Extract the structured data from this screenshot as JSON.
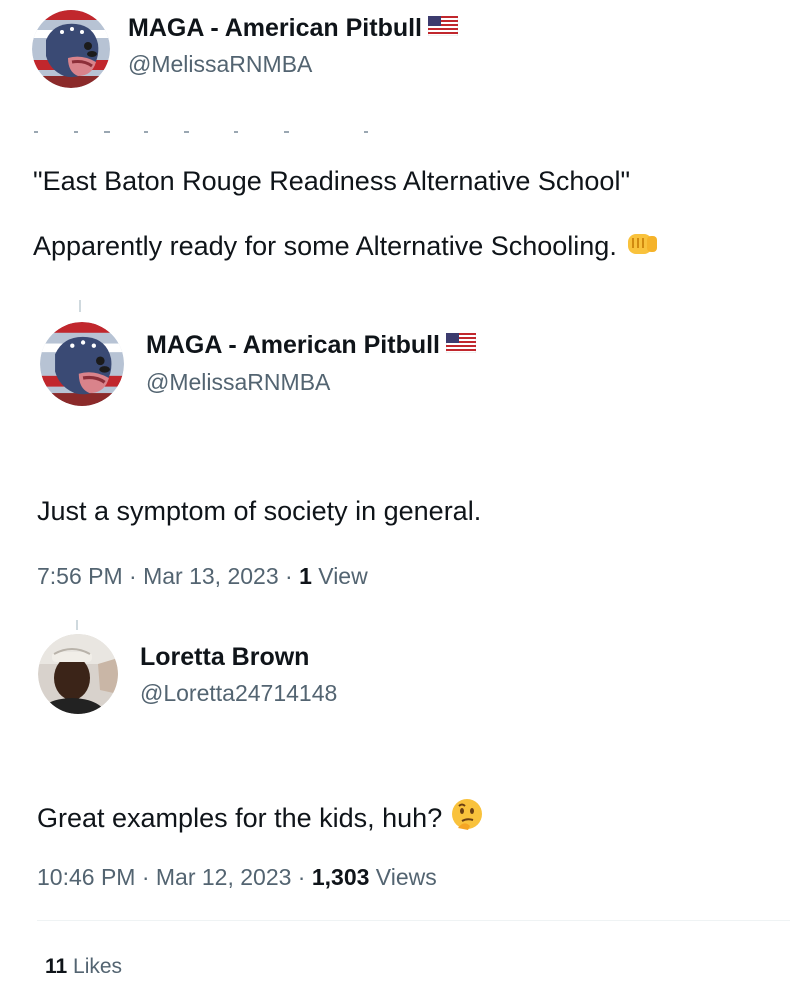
{
  "tweet1": {
    "name": "MAGA - American Pitbull",
    "flag": "us-flag-icon",
    "handle": "@MelissaRNMBA",
    "line1": "\"East Baton Rouge Readiness Alternative School\"",
    "line2": "Apparently ready for some Alternative Schooling.",
    "emoji": "oncoming-fist-icon"
  },
  "tweet2": {
    "name": "MAGA - American Pitbull",
    "flag": "us-flag-icon",
    "handle": "@MelissaRNMBA",
    "text": "Just a symptom of society in general.",
    "time": "7:56 PM · Mar 13, 2023 · ",
    "views_count": "1",
    "views_label": " View"
  },
  "tweet3": {
    "name": "Loretta Brown",
    "handle": "@Loretta24714148",
    "text": "Great examples for the kids, huh?",
    "emoji": "thinking-face-icon",
    "time": "10:46 PM · Mar 12, 2023 · ",
    "views_count": "1,303",
    "views_label": " Views"
  },
  "likes": {
    "count": "11",
    "label": " Likes"
  }
}
